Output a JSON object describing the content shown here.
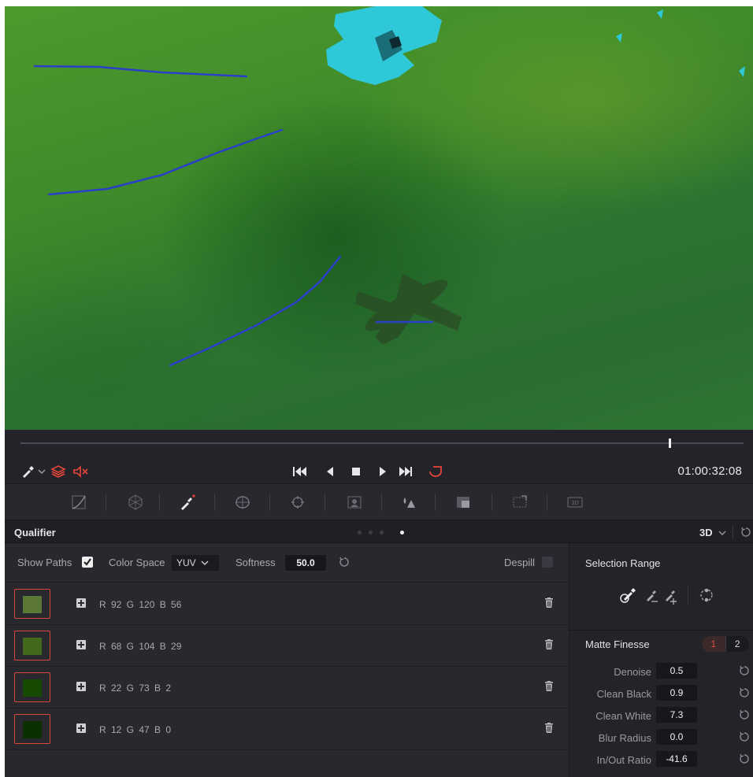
{
  "transport": {
    "timecode": "01:00:32:08",
    "playhead_fraction": 0.898
  },
  "qualifier": {
    "title": "Qualifier",
    "dimension_label": "3D",
    "show_paths_label": "Show Paths",
    "show_paths_checked": true,
    "color_space_label": "Color Space",
    "color_space_value": "YUV",
    "softness_label": "Softness",
    "softness_value": "50.0",
    "despill_label": "Despill",
    "despill_checked": false,
    "samples": [
      {
        "color": "#5c7838",
        "rgb": "R 92  G 120  B 56"
      },
      {
        "color": "#44681d",
        "rgb": "R 68  G 104  B 29"
      },
      {
        "color": "#164902",
        "rgb": "R 22  G 73  B 2"
      },
      {
        "color": "#0c2f00",
        "rgb": "R 12  G 47  B 0"
      }
    ]
  },
  "selection_range": {
    "title": "Selection Range"
  },
  "matte_finesse": {
    "title": "Matte Finesse",
    "tab_1": "1",
    "tab_2": "2",
    "params": [
      {
        "label": "Denoise",
        "value": "0.5"
      },
      {
        "label": "Clean Black",
        "value": "0.9"
      },
      {
        "label": "Clean White",
        "value": "7.3"
      },
      {
        "label": "Blur Radius",
        "value": "0.0"
      },
      {
        "label": "In/Out Ratio",
        "value": "-41.6"
      }
    ]
  },
  "colors": {
    "accent_red": "#e8453a",
    "path_blue": "#2b3fc8",
    "highlight_cyan": "#2ec8d8"
  }
}
